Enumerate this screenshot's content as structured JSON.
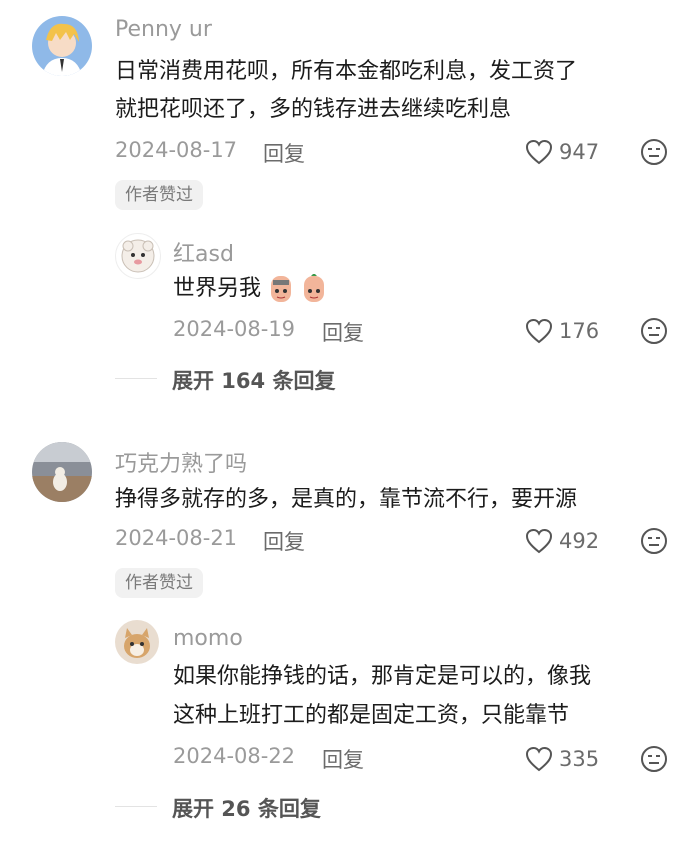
{
  "comments": [
    {
      "username": "Penny ur",
      "lines": [
        "日常消费用花呗，所有本金都吃利息，发工资了",
        "就把花呗还了，多的钱存进去继续吃利息"
      ],
      "date": "2024-08-17",
      "reply_label": "回复",
      "likes": "947",
      "badge": "作者赞过",
      "avatar_icon": "anime-boy-avatar",
      "reply": {
        "username": "红asd",
        "text": "世界另我",
        "date": "2024-08-19",
        "reply_label": "回复",
        "likes": "176",
        "avatar_icon": "cartoon-sheep-avatar"
      },
      "expand": "展开 164 条回复"
    },
    {
      "username": "巧克力熟了吗",
      "lines": [
        "挣得多就存的多，是真的，靠节流不行，要开源"
      ],
      "date": "2024-08-21",
      "reply_label": "回复",
      "likes": "492",
      "badge": "作者赞过",
      "avatar_icon": "dog-photo-avatar",
      "reply": {
        "username": "momo",
        "lines": [
          "如果你能挣钱的话，那肯定是可以的，像我",
          "这种上班打工的都是固定工资，只能靠节"
        ],
        "date": "2024-08-22",
        "reply_label": "回复",
        "likes": "335",
        "avatar_icon": "cat-photo-avatar"
      },
      "expand": "展开 26 条回复"
    }
  ],
  "colors": {
    "username": "#9a9a9a",
    "text": "#1c1c1c",
    "meta": "#9a9a9a",
    "badge_bg": "#f1f1f1"
  }
}
